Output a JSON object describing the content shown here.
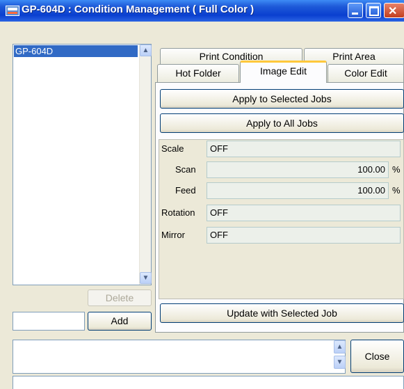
{
  "window": {
    "title": "GP-604D : Condition Management ( Full Color )"
  },
  "left_panel": {
    "list_items": [
      "GP-604D"
    ],
    "delete_label": "Delete",
    "add_label": "Add",
    "new_name_value": ""
  },
  "tabs": {
    "row_back": [
      "Print Condition",
      "Print Area"
    ],
    "row_front": [
      "Hot Folder",
      "Image Edit",
      "Color Edit"
    ],
    "active": "Image Edit"
  },
  "actions": {
    "apply_selected": "Apply to Selected Jobs",
    "apply_all": "Apply to All Jobs",
    "update_selected": "Update with Selected Job"
  },
  "image_edit": {
    "scale_label": "Scale",
    "scale_value": "OFF",
    "scan_label": "Scan",
    "scan_value": "100.00",
    "feed_label": "Feed",
    "feed_value": "100.00",
    "unit": "%",
    "rotation_label": "Rotation",
    "rotation_value": "OFF",
    "mirror_label": "Mirror",
    "mirror_value": "OFF"
  },
  "footer": {
    "close_label": "Close",
    "message": "",
    "status": ""
  },
  "icons": {
    "scroll_up": "chevron-up-icon",
    "scroll_down": "chevron-down-icon"
  }
}
